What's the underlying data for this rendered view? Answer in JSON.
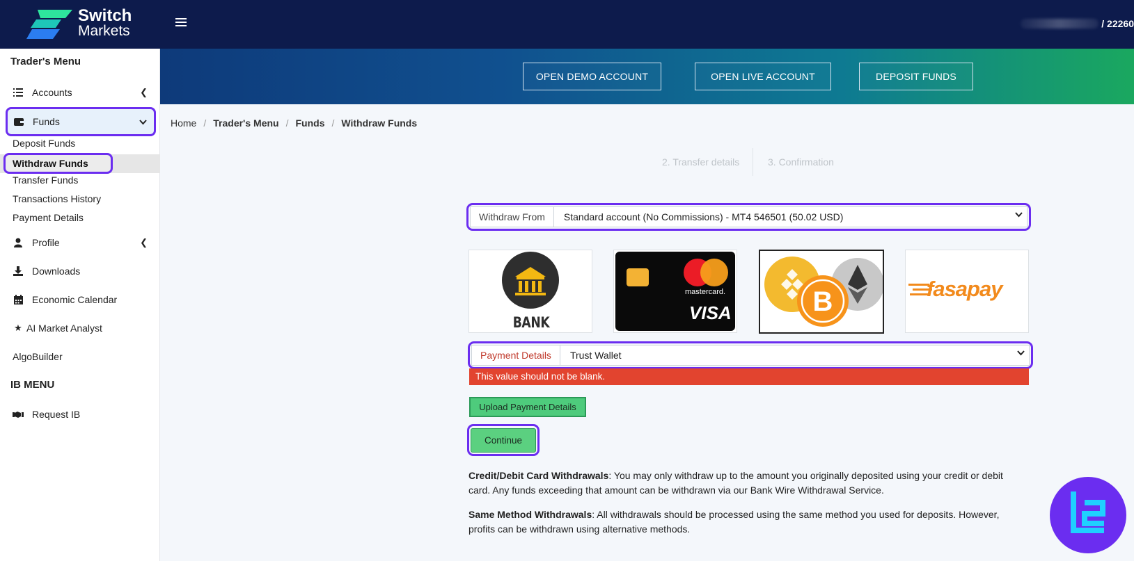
{
  "brand": {
    "line1": "Switch",
    "line2": "Markets"
  },
  "header": {
    "account_id": "/ 22260"
  },
  "sidebar": {
    "traders_menu_title": "Trader's Menu",
    "accounts": "Accounts",
    "funds": "Funds",
    "funds_sub": [
      "Deposit Funds",
      "Withdraw Funds",
      "Transfer Funds",
      "Transactions History",
      "Payment Details"
    ],
    "profile": "Profile",
    "downloads": "Downloads",
    "economic_calendar": "Economic Calendar",
    "ai_market_analyst": "AI Market Analyst",
    "algobuilder": "AlgoBuilder",
    "ib_menu_title": "IB MENU",
    "request_ib": "Request IB"
  },
  "banner": {
    "open_demo": "OPEN DEMO ACCOUNT",
    "open_live": "OPEN LIVE ACCOUNT",
    "deposit_funds": "DEPOSIT FUNDS"
  },
  "breadcrumb": [
    "Home",
    "Trader's Menu",
    "Funds",
    "Withdraw Funds"
  ],
  "steps": {
    "step2": "2. Transfer details",
    "step3": "3. Confirmation"
  },
  "form": {
    "withdraw_from_label": "Withdraw From",
    "withdraw_from_value": "Standard account (No Commissions) - MT4 546501 (50.02 USD)",
    "payment_details_label": "Payment Details",
    "payment_details_value": "Trust Wallet",
    "error_text": "This value should not be blank.",
    "upload_label": "Upload Payment Details",
    "continue_label": "Continue"
  },
  "methods": {
    "bank_transfer": "BANK TRANSFER",
    "card_brand1": "mastercard.",
    "card_brand2": "VISA",
    "fasapay": "fasapay",
    "selected": "crypto"
  },
  "notices": {
    "card_title": "Credit/Debit Card Withdrawals",
    "card_text": ": You may only withdraw up to the amount you originally deposited using your credit or debit card. Any funds exceeding that amount can be withdrawn via our Bank Wire Withdrawal Service.",
    "same_title": "Same Method Withdrawals",
    "same_text": ": All withdrawals should be processed using the same method you used for deposits. However, profits can be withdrawn using alternative methods."
  },
  "colors": {
    "topbar": "#0d1b4c",
    "highlight": "#6b2df0",
    "error": "#e2442f",
    "button_green": "#4ecb7c"
  }
}
